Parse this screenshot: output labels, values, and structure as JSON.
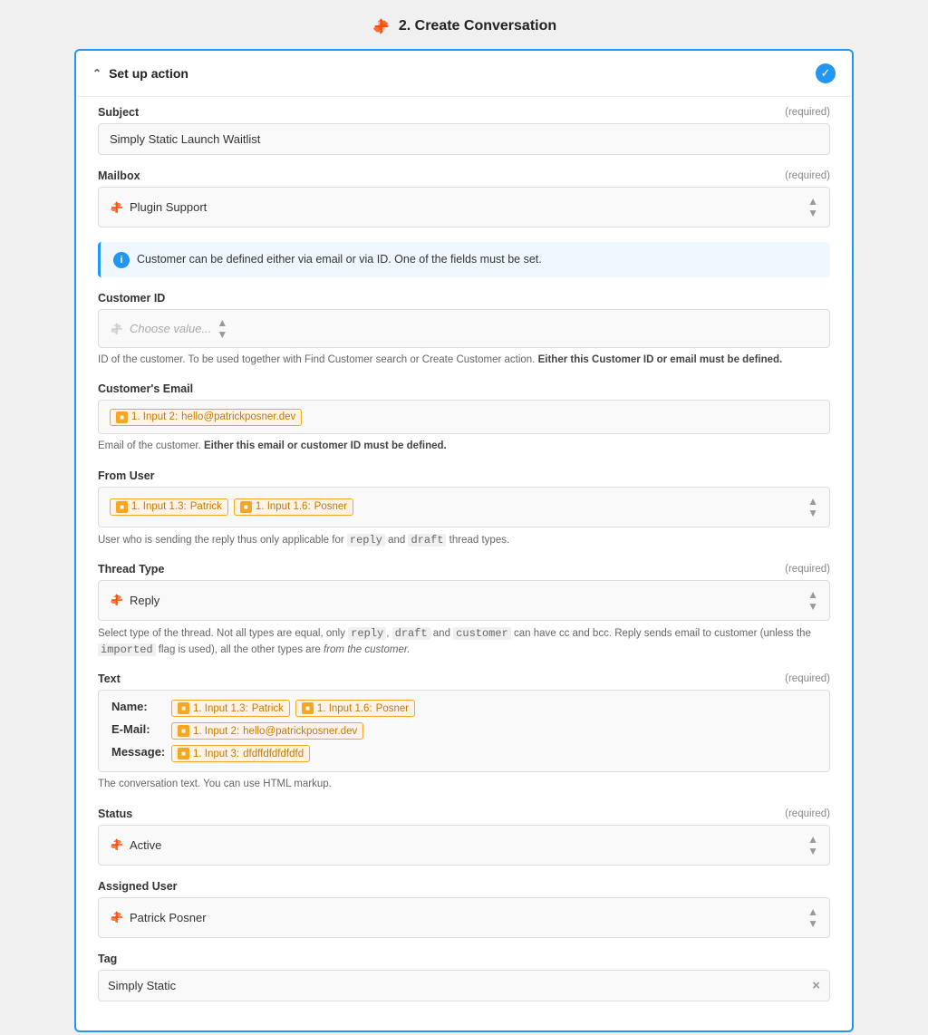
{
  "page": {
    "title": "2. Create Conversation",
    "icon": "zapier-icon"
  },
  "card": {
    "header_label": "Set up action",
    "verified": true
  },
  "form": {
    "subject": {
      "label": "Subject",
      "required": "(required)",
      "value": "Simply Static Launch Waitlist"
    },
    "mailbox": {
      "label": "Mailbox",
      "required": "(required)",
      "value": "Plugin Support"
    },
    "info_message": "Customer can be defined either via email or via ID. One of the fields must be set.",
    "customer_id": {
      "label": "Customer ID",
      "placeholder": "Choose value...",
      "helper": "ID of the customer. To be used together with Find Customer search or Create Customer action.",
      "helper_bold": "Either this Customer ID or email must be defined."
    },
    "customer_email": {
      "label": "Customer's Email",
      "token_label": "1. Input 2:",
      "token_value": "hello@patrickposner.dev",
      "helper": "Email of the customer.",
      "helper_bold": "Either this email or customer ID must be defined."
    },
    "from_user": {
      "label": "From User",
      "tokens": [
        {
          "label": "1. Input 1.3:",
          "value": "Patrick"
        },
        {
          "label": "1. Input 1.6:",
          "value": "Posner"
        }
      ],
      "helper": "User who is sending the reply thus only applicable for",
      "helper_code1": "reply",
      "helper_and": "and",
      "helper_code2": "draft",
      "helper_end": "thread types."
    },
    "thread_type": {
      "label": "Thread Type",
      "required": "(required)",
      "value": "Reply"
    },
    "thread_type_helper": "Select type of the thread. Not all types are equal, only",
    "thread_type_codes": [
      "reply",
      "draft",
      "customer"
    ],
    "thread_type_helper2": "can have cc and bcc. Reply sends email to customer (unless the",
    "thread_type_code3": "imported",
    "thread_type_helper3": "flag is used), all the other types are",
    "thread_type_italic": "from the customer.",
    "text": {
      "label": "Text",
      "required": "(required)",
      "rows": [
        {
          "label": "Name:",
          "tokens": [
            {
              "label": "1. Input 1.3:",
              "value": "Patrick"
            },
            {
              "label": "1. Input 1.6:",
              "value": "Posner"
            }
          ]
        },
        {
          "label": "E-Mail:",
          "tokens": [
            {
              "label": "1. Input 2:",
              "value": "hello@patrickposner.dev"
            }
          ]
        },
        {
          "label": "Message:",
          "tokens": [
            {
              "label": "1. Input 3:",
              "value": "dfdffdfdfdfdfd"
            }
          ]
        }
      ],
      "helper": "The conversation text. You can use HTML markup."
    },
    "status": {
      "label": "Status",
      "required": "(required)",
      "value": "Active"
    },
    "assigned_user": {
      "label": "Assigned User",
      "value": "Patrick Posner"
    },
    "tag": {
      "label": "Tag",
      "value": "Simply Static"
    }
  },
  "buttons": {
    "clear_tag": "×"
  }
}
